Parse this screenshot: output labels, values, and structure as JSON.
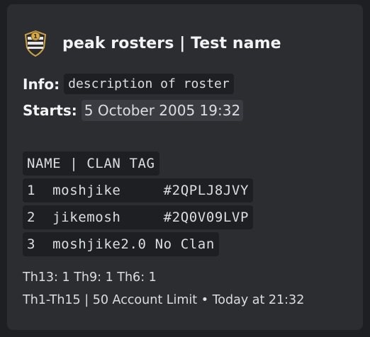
{
  "embed": {
    "author_name": "peak rosters | Test name",
    "author_icon": "shield-badge-icon",
    "info_label": "Info:",
    "info_value": "description of roster",
    "starts_label": "Starts:",
    "starts_value": "5 October 2005 19:32",
    "table_header": "NAME | CLAN TAG",
    "table_rows": [
      {
        "text": "1  moshjike     #2QPLJ8JVY"
      },
      {
        "text": "2  jikemosh     #2Q0V09LVP"
      },
      {
        "text": "3  moshjike2.0 No Clan"
      }
    ],
    "footer_line1": "Th13: 1 Th9: 1 Th6: 1",
    "footer_line2": "Th1-Th15 | 50 Account Limit • Today at 21:32"
  },
  "colors": {
    "background": "#1e1f22",
    "embed_background": "#2b2d31",
    "code_background": "#1e1f22",
    "text": "#dbdee1",
    "heading": "#f2f3f5"
  }
}
